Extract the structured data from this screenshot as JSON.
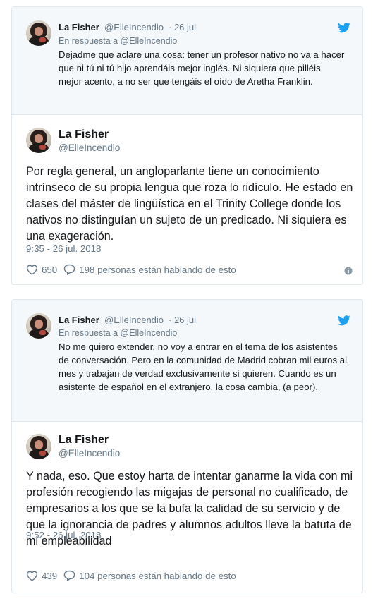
{
  "colors": {
    "twitter_blue": "#1da1f2",
    "secondary_text": "#657786",
    "border": "#e1e8ed",
    "quoted_bg": "#f5f8fa"
  },
  "tweets": [
    {
      "quoted": {
        "name": "La Fisher",
        "handle": "@ElleIncendio",
        "date": "· 26 jul",
        "reply_to": "En respuesta a @ElleIncendio",
        "text": "Dejadme que aclare una cosa: tener un profesor nativo no va a hacer que ni tú ni tú hijo aprendáis mejor inglés. Ni siquiera que pilléis mejor acento, a no ser que tengáis el oído de Aretha Franklin.",
        "icon": "twitter-bird-icon"
      },
      "main": {
        "name": "La Fisher",
        "handle": "@ElleIncendio",
        "text": "Por regla general, un angloparlante tiene un conocimiento intrínseco de su propia lengua que roza lo ridículo. He estado en clases del máster de lingüística en el Trinity College donde los nativos no distinguían un sujeto de un predicado. Ni siquiera es una exageración.",
        "timestamp": "9:35 - 26 jul. 2018",
        "likes": "650",
        "talking": "198 personas están hablando de esto"
      }
    },
    {
      "quoted": {
        "name": "La Fisher",
        "handle": "@ElleIncendio",
        "date": "· 26 jul",
        "reply_to": "En respuesta a @ElleIncendio",
        "text": "No me quiero extender, no voy a entrar en el tema de los asistentes de conversación. Pero en la comunidad de Madrid cobran mil euros al mes y trabajan de verdad exclusivamente si quieren. Cuando es un asistente de español en el extranjero, la cosa cambia, (a peor).",
        "icon": "twitter-bird-icon"
      },
      "main": {
        "name": "La Fisher",
        "handle": "@ElleIncendio",
        "text": "Y nada, eso. Que estoy harta de intentar ganarme la vida con mi profesión recogiendo las migajas de personal no cualificado, de empresarios a los que se la bufa la calidad de su servicio y de que la ignorancia de padres y alumnos adultos lleve la batuta de mi empleabilidad",
        "timestamp": "9:52 - 26 jul. 2018",
        "likes": "439",
        "talking": "104 personas están hablando de esto"
      }
    }
  ]
}
